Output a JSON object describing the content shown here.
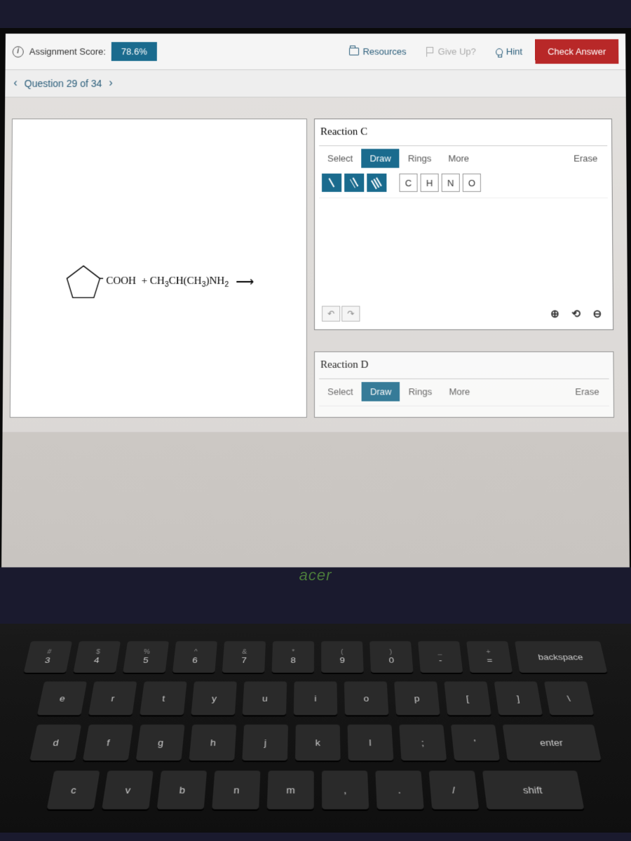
{
  "toolbar": {
    "score_label": "Assignment Score:",
    "score_value": "78.6%",
    "resources": "Resources",
    "give_up": "Give Up?",
    "hint": "Hint",
    "check": "Check Answer"
  },
  "nav": {
    "question": "Question 29 of 34"
  },
  "reaction": {
    "formula_html": "COOH  + CH₃CH(CH₃)NH₂",
    "arrow": "⟶"
  },
  "panelC": {
    "title": "Reaction C",
    "tabs": {
      "select": "Select",
      "draw": "Draw",
      "rings": "Rings",
      "more": "More"
    },
    "erase": "Erase",
    "atoms": [
      "C",
      "H",
      "N",
      "O"
    ]
  },
  "panelD": {
    "title": "Reaction D",
    "tabs": {
      "select": "Select",
      "draw": "Draw",
      "rings": "Rings",
      "more": "More"
    },
    "erase": "Erase"
  },
  "brand": "acer",
  "keyboard": {
    "row1": [
      {
        "t": "#",
        "b": "3"
      },
      {
        "t": "$",
        "b": "4"
      },
      {
        "t": "%",
        "b": "5"
      },
      {
        "t": "^",
        "b": "6"
      },
      {
        "t": "&",
        "b": "7"
      },
      {
        "t": "*",
        "b": "8"
      },
      {
        "t": "(",
        "b": "9"
      },
      {
        "t": ")",
        "b": "0"
      },
      {
        "t": "_",
        "b": "-"
      },
      {
        "t": "+",
        "b": "="
      },
      {
        "t": "",
        "b": "backspace"
      }
    ],
    "row2": [
      "e",
      "r",
      "t",
      "y",
      "u",
      "i",
      "o",
      "p",
      "[",
      "]",
      "\\"
    ],
    "row3": [
      "d",
      "f",
      "g",
      "h",
      "j",
      "k",
      "l",
      ";",
      "'",
      "enter"
    ],
    "row4": [
      "c",
      "v",
      "b",
      "n",
      "m",
      ",",
      ".",
      "/",
      "shift"
    ]
  }
}
